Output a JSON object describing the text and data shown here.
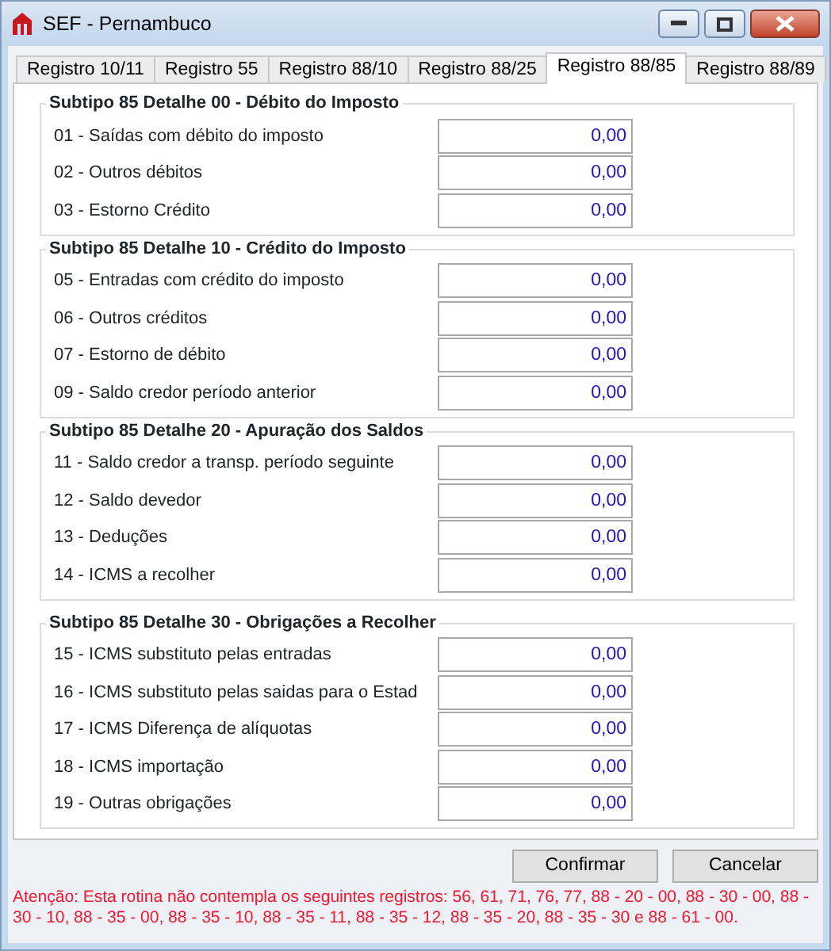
{
  "window": {
    "title": "SEF - Pernambuco"
  },
  "tabs": [
    {
      "label": "Registro 10/11",
      "selected": false
    },
    {
      "label": "Registro 55",
      "selected": false
    },
    {
      "label": "Registro 88/10",
      "selected": false
    },
    {
      "label": "Registro 88/25",
      "selected": false
    },
    {
      "label": "Registro 88/85",
      "selected": true
    },
    {
      "label": "Registro 88/89",
      "selected": false
    }
  ],
  "groups": [
    {
      "title": "Subtipo 85 Detalhe 00 - Débito do Imposto",
      "fields": [
        {
          "label": "01 - Saídas com débito do imposto",
          "value": "0,00"
        },
        {
          "label": "02 - Outros débitos",
          "value": "0,00"
        },
        {
          "label": "03 - Estorno Crédito",
          "value": "0,00"
        }
      ]
    },
    {
      "title": "Subtipo 85 Detalhe 10 - Crédito do Imposto",
      "fields": [
        {
          "label": "05 - Entradas com crédito do imposto",
          "value": "0,00"
        },
        {
          "label": "06 - Outros créditos",
          "value": "0,00"
        },
        {
          "label": "07 - Estorno de débito",
          "value": "0,00"
        },
        {
          "label": "09 - Saldo credor período anterior",
          "value": "0,00"
        }
      ]
    },
    {
      "title": "Subtipo 85 Detalhe 20 - Apuração dos Saldos",
      "fields": [
        {
          "label": "11 - Saldo credor a transp. período seguinte",
          "value": "0,00"
        },
        {
          "label": "12 - Saldo devedor",
          "value": "0,00"
        },
        {
          "label": "13 - Deduções",
          "value": "0,00"
        },
        {
          "label": "14 - ICMS a recolher",
          "value": "0,00"
        }
      ]
    },
    {
      "title": "Subtipo 85 Detalhe 30 - Obrigações a Recolher",
      "fields": [
        {
          "label": "15 - ICMS substituto pelas entradas",
          "value": "0,00"
        },
        {
          "label": "16 - ICMS substituto pelas saidas para o Estad",
          "value": "0,00"
        },
        {
          "label": "17 - ICMS Diferença de alíquotas",
          "value": "0,00"
        },
        {
          "label": "18 - ICMS importação",
          "value": "0,00"
        },
        {
          "label": "19 - Outras obrigações",
          "value": "0,00"
        }
      ]
    }
  ],
  "buttons": [
    "Confirmar",
    "Cancelar"
  ],
  "warning": "Atenção: Esta rotina não contempla os seguintes registros: 56, 61, 71, 76, 77, 88 - 20 - 00, 88 - 30 - 00, 88 - 30 - 10, 88 - 35 - 00, 88 - 35 - 10, 88 - 35 - 11, 88 - 35 - 12, 88 - 35 - 20, 88 - 35 - 30 e 88 - 61 - 00."
}
